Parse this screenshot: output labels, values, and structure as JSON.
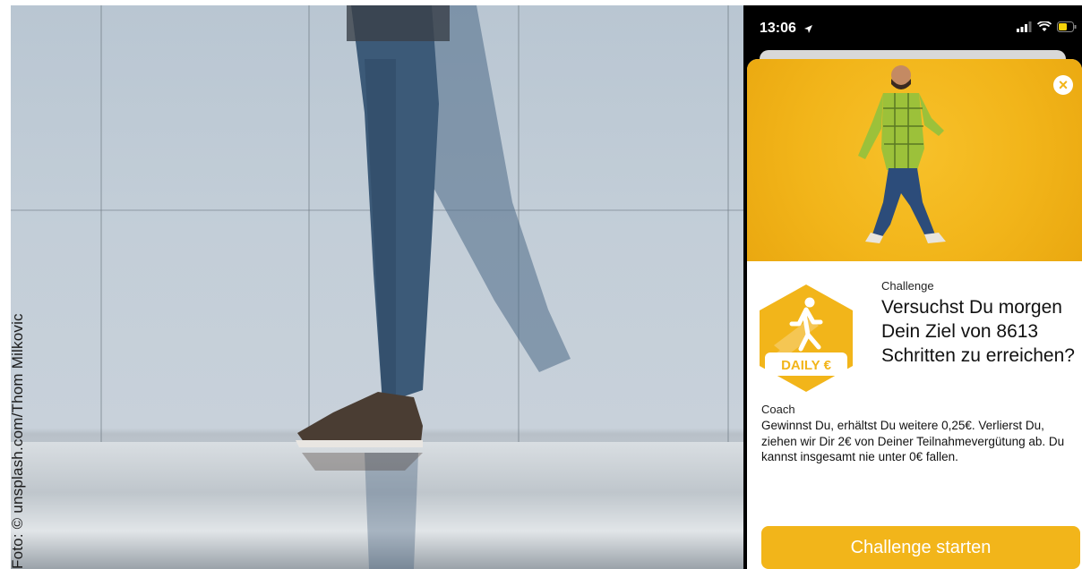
{
  "photo": {
    "credit": "Foto: © unsplash.com/Thom Milkovic"
  },
  "status_bar": {
    "time": "13:06"
  },
  "card": {
    "close_icon": "close-icon",
    "badge": {
      "text": "DAILY €",
      "icon": "walking-person-icon"
    },
    "challenge_label": "Challenge",
    "title": "Versuchst Du morgen Dein Ziel von 8613 Schritten zu erreichen?",
    "coach_label": "Coach",
    "coach_text": "Gewinnst Du, erhältst Du weitere 0,25€. Verlierst Du, ziehen wir Dir 2€ von Deiner Teilnahmevergütung ab. Du kannst insgesamt nie unter 0€ fallen.",
    "cta_label": "Challenge starten"
  },
  "colors": {
    "accent": "#f2b51a"
  }
}
